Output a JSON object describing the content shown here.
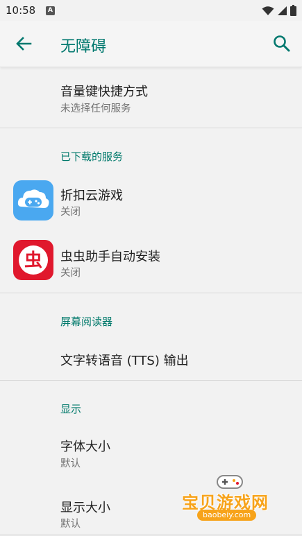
{
  "status": {
    "time": "10:58",
    "notif_icon": "A"
  },
  "appbar": {
    "title": "无障碍",
    "back_icon": "arrow-left-icon",
    "search_icon": "search-icon"
  },
  "items": {
    "volume_shortcut": {
      "title": "音量键快捷方式",
      "sub": "未选择任何服务"
    },
    "section_downloaded": "已下载的服务",
    "app1": {
      "title": "折扣云游戏",
      "sub": "关闭"
    },
    "app2": {
      "title": "虫虫助手自动安装",
      "sub": "关闭"
    },
    "section_reader": "屏幕阅读器",
    "tts": {
      "title": "文字转语音 (TTS) 输出"
    },
    "section_display": "显示",
    "font_size": {
      "title": "字体大小",
      "sub": "默认"
    },
    "display_size": {
      "title": "显示大小",
      "sub": "默认"
    }
  },
  "watermark": {
    "text": "宝贝游戏网",
    "url": "baobeiy.com"
  },
  "colors": {
    "accent": "#00796b",
    "background": "#f2f2f2",
    "app1_icon": "#4aa8f0",
    "app2_icon": "#e0182d",
    "watermark": "#f7a31a"
  }
}
